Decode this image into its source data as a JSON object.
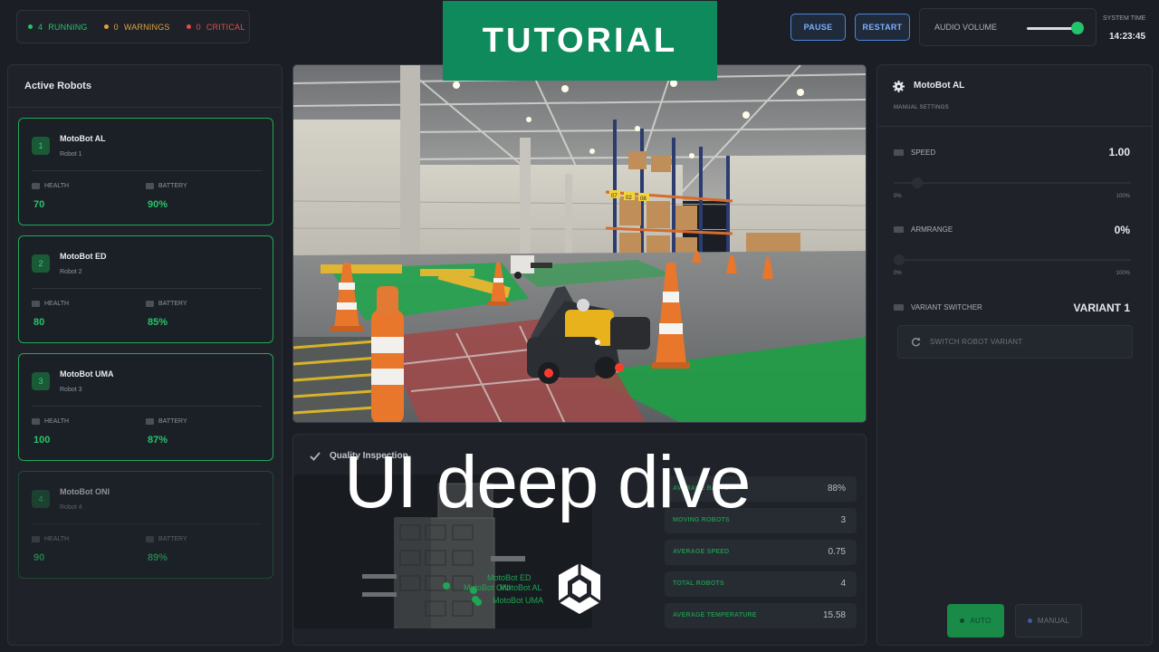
{
  "status": {
    "running": {
      "count": "4",
      "label": "RUNNING",
      "color": "#21c46b"
    },
    "warnings": {
      "count": "0",
      "label": "WARNINGS",
      "color": "#e0a33a"
    },
    "critical": {
      "count": "0",
      "label": "CRITICAL",
      "color": "#e04b4b"
    }
  },
  "banner": {
    "tutorial": "TUTORIAL",
    "overlay": "UI deep dive"
  },
  "topbar": {
    "pause_label": "PAUSE",
    "restart_label": "RESTART",
    "audio_label": "AUDIO VOLUME",
    "audio_volume": 0.9,
    "system_time_label": "SYSTEM TIME",
    "system_time": "14:23:45"
  },
  "left_panel": {
    "title": "Active Robots",
    "health_label": "HEALTH",
    "battery_label": "BATTERY",
    "robots": [
      {
        "num": "1",
        "name": "MotoBot AL",
        "sub": "Robot 1",
        "health": "70",
        "battery": "90%"
      },
      {
        "num": "2",
        "name": "MotoBot ED",
        "sub": "Robot 2",
        "health": "80",
        "battery": "85%"
      },
      {
        "num": "3",
        "name": "MotoBot UMA",
        "sub": "Robot 3",
        "health": "100",
        "battery": "87%"
      },
      {
        "num": "4",
        "name": "MotoBot ONI",
        "sub": "Robot 4",
        "health": "90",
        "battery": "89%"
      }
    ]
  },
  "viewport": {
    "rack_labels": [
      "07",
      "02",
      "08"
    ]
  },
  "inspection": {
    "title": "Quality Inspection",
    "map_labels": [
      "MotoBot ED",
      "MotoBot ONI",
      "MotoBot AL",
      "MotoBot UMA"
    ],
    "metrics": [
      {
        "label": "AVERAGE BATTERY",
        "value": "88%"
      },
      {
        "label": "MOVING ROBOTS",
        "value": "3"
      },
      {
        "label": "AVERAGE SPEED",
        "value": "0.75"
      },
      {
        "label": "TOTAL ROBOTS",
        "value": "4"
      },
      {
        "label": "AVERAGE TEMPERATURE",
        "value": "15.58"
      }
    ]
  },
  "right_panel": {
    "robot_name": "MotoBot AL",
    "subtitle": "MANUAL SETTINGS",
    "speed_label": "SPEED",
    "speed_value": "1.00",
    "speed_min": "0%",
    "speed_max": "100%",
    "speed_level": 0.1,
    "armrange_label": "ARMRANGE",
    "armrange_value": "0%",
    "armrange_min": "0%",
    "armrange_max": "100%",
    "armrange_level": 0.0,
    "variant_label": "VARIANT SWITCHER",
    "variant_value": "VARIANT 1",
    "switch_label": "SWITCH ROBOT VARIANT",
    "auto_label": "AUTO",
    "manual_label": "MANUAL"
  },
  "colors": {
    "accent": "#21c46b",
    "banner": "#0f8a5c",
    "button_blue": "#4f86d8"
  }
}
